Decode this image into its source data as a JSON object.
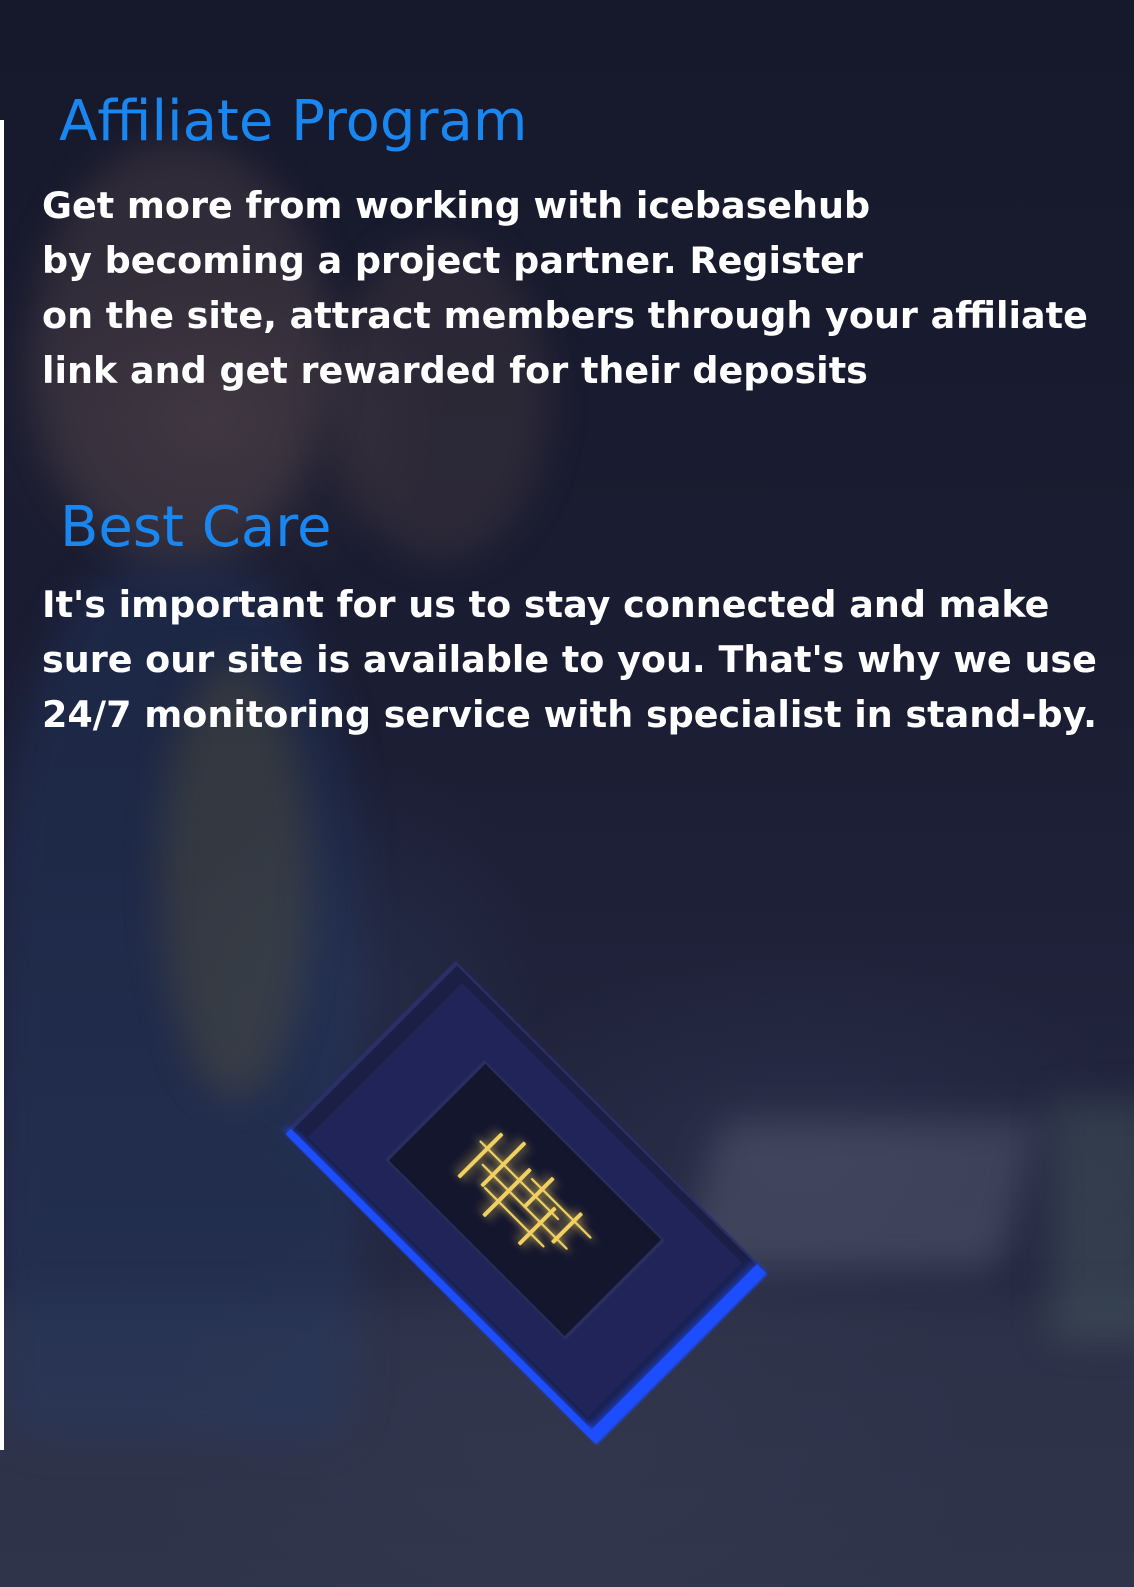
{
  "affiliate": {
    "title": "Affiliate Program",
    "lines": [
      "Get more from working with icebasehub",
      "by becoming a project partner. Register",
      "on the site, attract members through your affiliate",
      "link and get rewarded for their deposits"
    ]
  },
  "care": {
    "title": "Best Care",
    "lines": [
      "It's important for us to stay connected and make",
      "sure our site is available to you. That's why we use",
      "24/7 monitoring service with specialist in stand-by."
    ]
  },
  "colors": {
    "heading": "#1a86f0",
    "body_text": "#ffffff",
    "background": "#151728",
    "chip_glow": "#1f4dff",
    "circuit": "#f0d060"
  },
  "images": {
    "background": "office-team-photo",
    "illustration": "glowing-microchip-icon"
  }
}
